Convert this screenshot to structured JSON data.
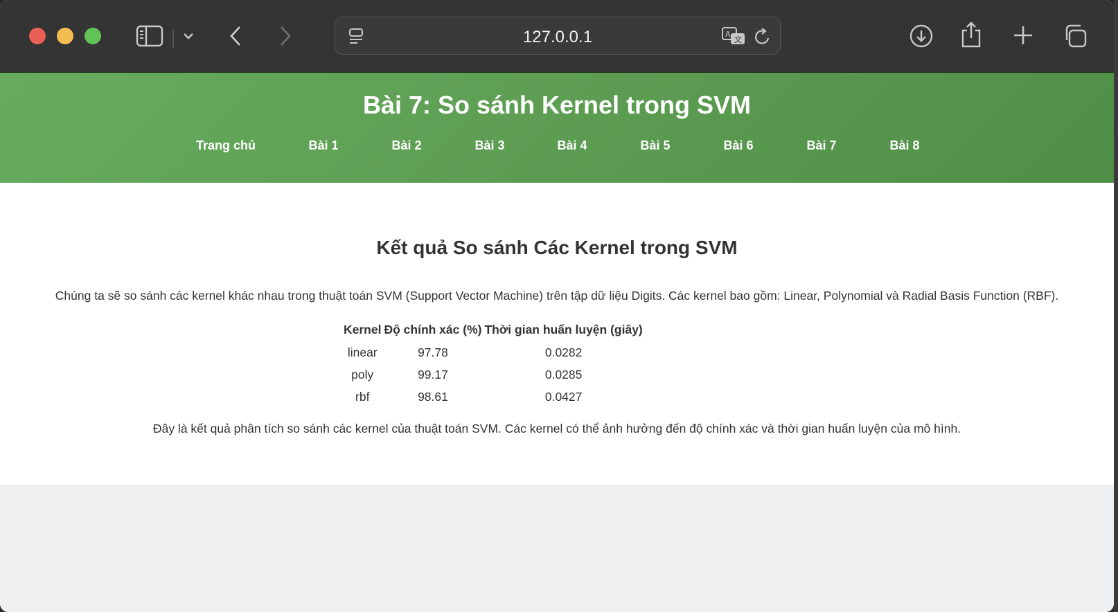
{
  "browser": {
    "url": "127.0.0.1"
  },
  "header": {
    "title": "Bài 7: So sánh Kernel trong SVM",
    "nav": [
      "Trang chủ",
      "Bài 1",
      "Bài 2",
      "Bài 3",
      "Bài 4",
      "Bài 5",
      "Bài 6",
      "Bài 7",
      "Bài 8"
    ]
  },
  "main": {
    "title": "Kết quả So sánh Các Kernel trong SVM",
    "intro": "Chúng ta sẽ so sánh các kernel khác nhau trong thuật toán SVM (Support Vector Machine) trên tập dữ liệu Digits. Các kernel bao gồm: Linear, Polynomial và Radial Basis Function (RBF).",
    "table": {
      "headers": [
        "Kernel",
        "Độ chính xác (%)",
        "Thời gian huấn luyện (giây)"
      ],
      "rows": [
        [
          "linear",
          "97.78",
          "0.0282"
        ],
        [
          "poly",
          "99.17",
          "0.0285"
        ],
        [
          "rbf",
          "98.61",
          "0.0427"
        ]
      ]
    },
    "outro": "Đây là kết quả phân tích so sánh các kernel của thuật toán SVM. Các kernel có thể ảnh hưởng đến độ chính xác và thời gian huấn luyện của mô hình."
  },
  "colors": {
    "header_green": "#5fa356",
    "toolbar": "#343434"
  }
}
